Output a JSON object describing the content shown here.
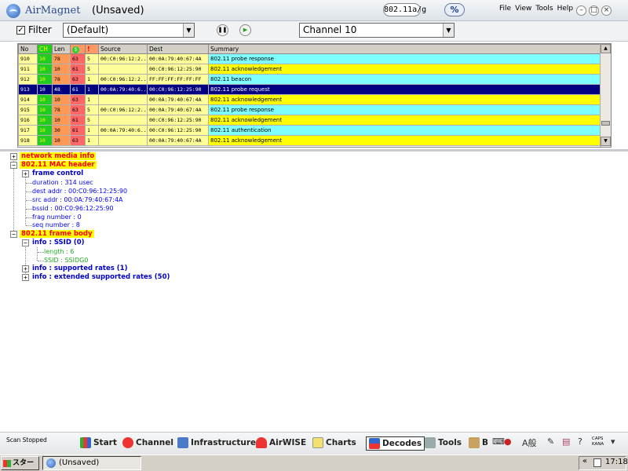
{
  "titlebar": {
    "app_name": "AirMagnet",
    "doc_title": "(Unsaved)",
    "standard": "802.11a/g",
    "percent_btn": "%",
    "menu": [
      "File",
      "View",
      "Tools",
      "Help"
    ],
    "window_buttons": [
      "–",
      "□",
      "×"
    ]
  },
  "toolbar": {
    "filter_checked": "✓",
    "filter_label": "Filter",
    "filter_value": "(Default)",
    "channel_value": "Channel 10"
  },
  "packets": {
    "columns": [
      "No",
      "CH",
      "Len",
      "S",
      "!",
      "Source",
      "Dest",
      "Summary"
    ],
    "rows": [
      {
        "no": "910",
        "ch": "10",
        "len": "78",
        "sig": "63",
        "r": "5",
        "src": "00:C0:96:12:2...",
        "dst": "00:0A:79:40:67:4A",
        "summary": "802.11 probe response",
        "color": "#80ffff"
      },
      {
        "no": "911",
        "ch": "10",
        "len": "10",
        "sig": "61",
        "r": "5",
        "src": "",
        "dst": "00:C0:96:12:25:90",
        "summary": "802.11 acknowledgement",
        "color": "#ffff00"
      },
      {
        "no": "912",
        "ch": "10",
        "len": "78",
        "sig": "63",
        "r": "1",
        "src": "00:C0:96:12:2...",
        "dst": "FF:FF:FF:FF:FF:FF",
        "summary": "802.11 beacon",
        "color": "#80ffff"
      },
      {
        "no": "913",
        "ch": "10",
        "len": "48",
        "sig": "61",
        "r": "1",
        "src": "00:0A:79:40:6...",
        "dst": "00:C0:96:12:25:90",
        "summary": "802.11 probe request",
        "color": "#ffff00",
        "selected": true
      },
      {
        "no": "914",
        "ch": "10",
        "len": "10",
        "sig": "63",
        "r": "1",
        "src": "",
        "dst": "00:0A:79:40:67:4A",
        "summary": "802.11 acknowledgement",
        "color": "#ffff00"
      },
      {
        "no": "915",
        "ch": "10",
        "len": "78",
        "sig": "63",
        "r": "5",
        "src": "00:C0:96:12:2...",
        "dst": "00:0A:79:40:67:4A",
        "summary": "802.11 probe response",
        "color": "#80ffff"
      },
      {
        "no": "916",
        "ch": "10",
        "len": "10",
        "sig": "61",
        "r": "5",
        "src": "",
        "dst": "00:C0:96:12:25:90",
        "summary": "802.11 acknowledgement",
        "color": "#ffff00"
      },
      {
        "no": "917",
        "ch": "10",
        "len": "30",
        "sig": "61",
        "r": "1",
        "src": "00:0A:79:40:6...",
        "dst": "00:C0:96:12:25:90",
        "summary": "802.11 authentication",
        "color": "#80ffff"
      },
      {
        "no": "918",
        "ch": "10",
        "len": "10",
        "sig": "63",
        "r": "1",
        "src": "",
        "dst": "00:0A:79:40:67:4A",
        "summary": "802.11 acknowledgement",
        "color": "#ffff00"
      }
    ]
  },
  "decode": {
    "network_media_info": "network media info",
    "mac_header": "802.11 MAC header",
    "frame_control": "frame control",
    "duration": "duration : 314 usec",
    "dest_addr": "dest addr : 00:C0:96:12:25:90",
    "src_addr": "src  addr : 00:0A:79:40:67:4A",
    "bssid": "bssid : 00:C0:96:12:25:90",
    "frag_number": "frag number : 0",
    "seq_number": "seq number : 8",
    "frame_body": "802.11 frame body",
    "info_ssid": "info : SSID (0)",
    "ssid_length": "length : 6",
    "ssid_value": "SSID : SSIDG0",
    "supported_rates": "info : supported rates (1)",
    "ext_supported_rates": "info : extended supported rates (50)"
  },
  "bottom": {
    "status": "Scan Stopped",
    "nav": [
      "Start",
      "Channel",
      "Infrastructure",
      "AirWISE",
      "Charts",
      "Decodes",
      "Tools",
      "B"
    ],
    "active": "Decodes",
    "caps": "CAPS",
    "kana": "KANA"
  },
  "taskbar": {
    "start": "スタート",
    "item": "(Unsaved)",
    "time": "17:18"
  }
}
